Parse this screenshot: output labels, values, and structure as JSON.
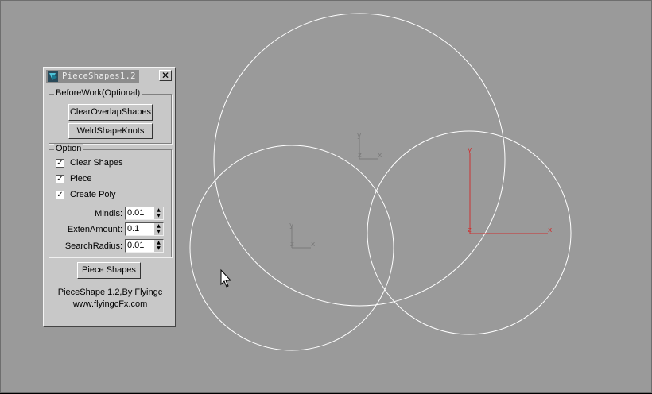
{
  "panel": {
    "title": "PieceShapes1.2",
    "close_glyph": "✕",
    "before_work": {
      "label": "BeforeWork(Optional)",
      "clear_overlap_label": "ClearOverlapShapes",
      "weld_label": "WeldShapeKnots"
    },
    "option": {
      "label": "Option",
      "checkboxes": [
        {
          "label": "Clear Shapes",
          "checked": true
        },
        {
          "label": "Piece",
          "checked": true
        },
        {
          "label": "Create Poly",
          "checked": true
        }
      ],
      "spinners": [
        {
          "label": "Mindis:",
          "value": "0.01"
        },
        {
          "label": "ExtenAmount:",
          "value": "0.1"
        },
        {
          "label": "SearchRadius:",
          "value": "0.01"
        }
      ]
    },
    "piece_shapes_label": "Piece Shapes",
    "credit": "PieceShape 1.2,By Flyingc",
    "website": "www.flyingcFx.com"
  },
  "viewport": {
    "background": "#9a9a9a",
    "shape_color": "#ffffff",
    "selected_gizmo_color": "#cc3333",
    "gizmo_color": "#7a7a7a",
    "axis_x": "x",
    "axis_y": "y",
    "axis_z": "z"
  }
}
